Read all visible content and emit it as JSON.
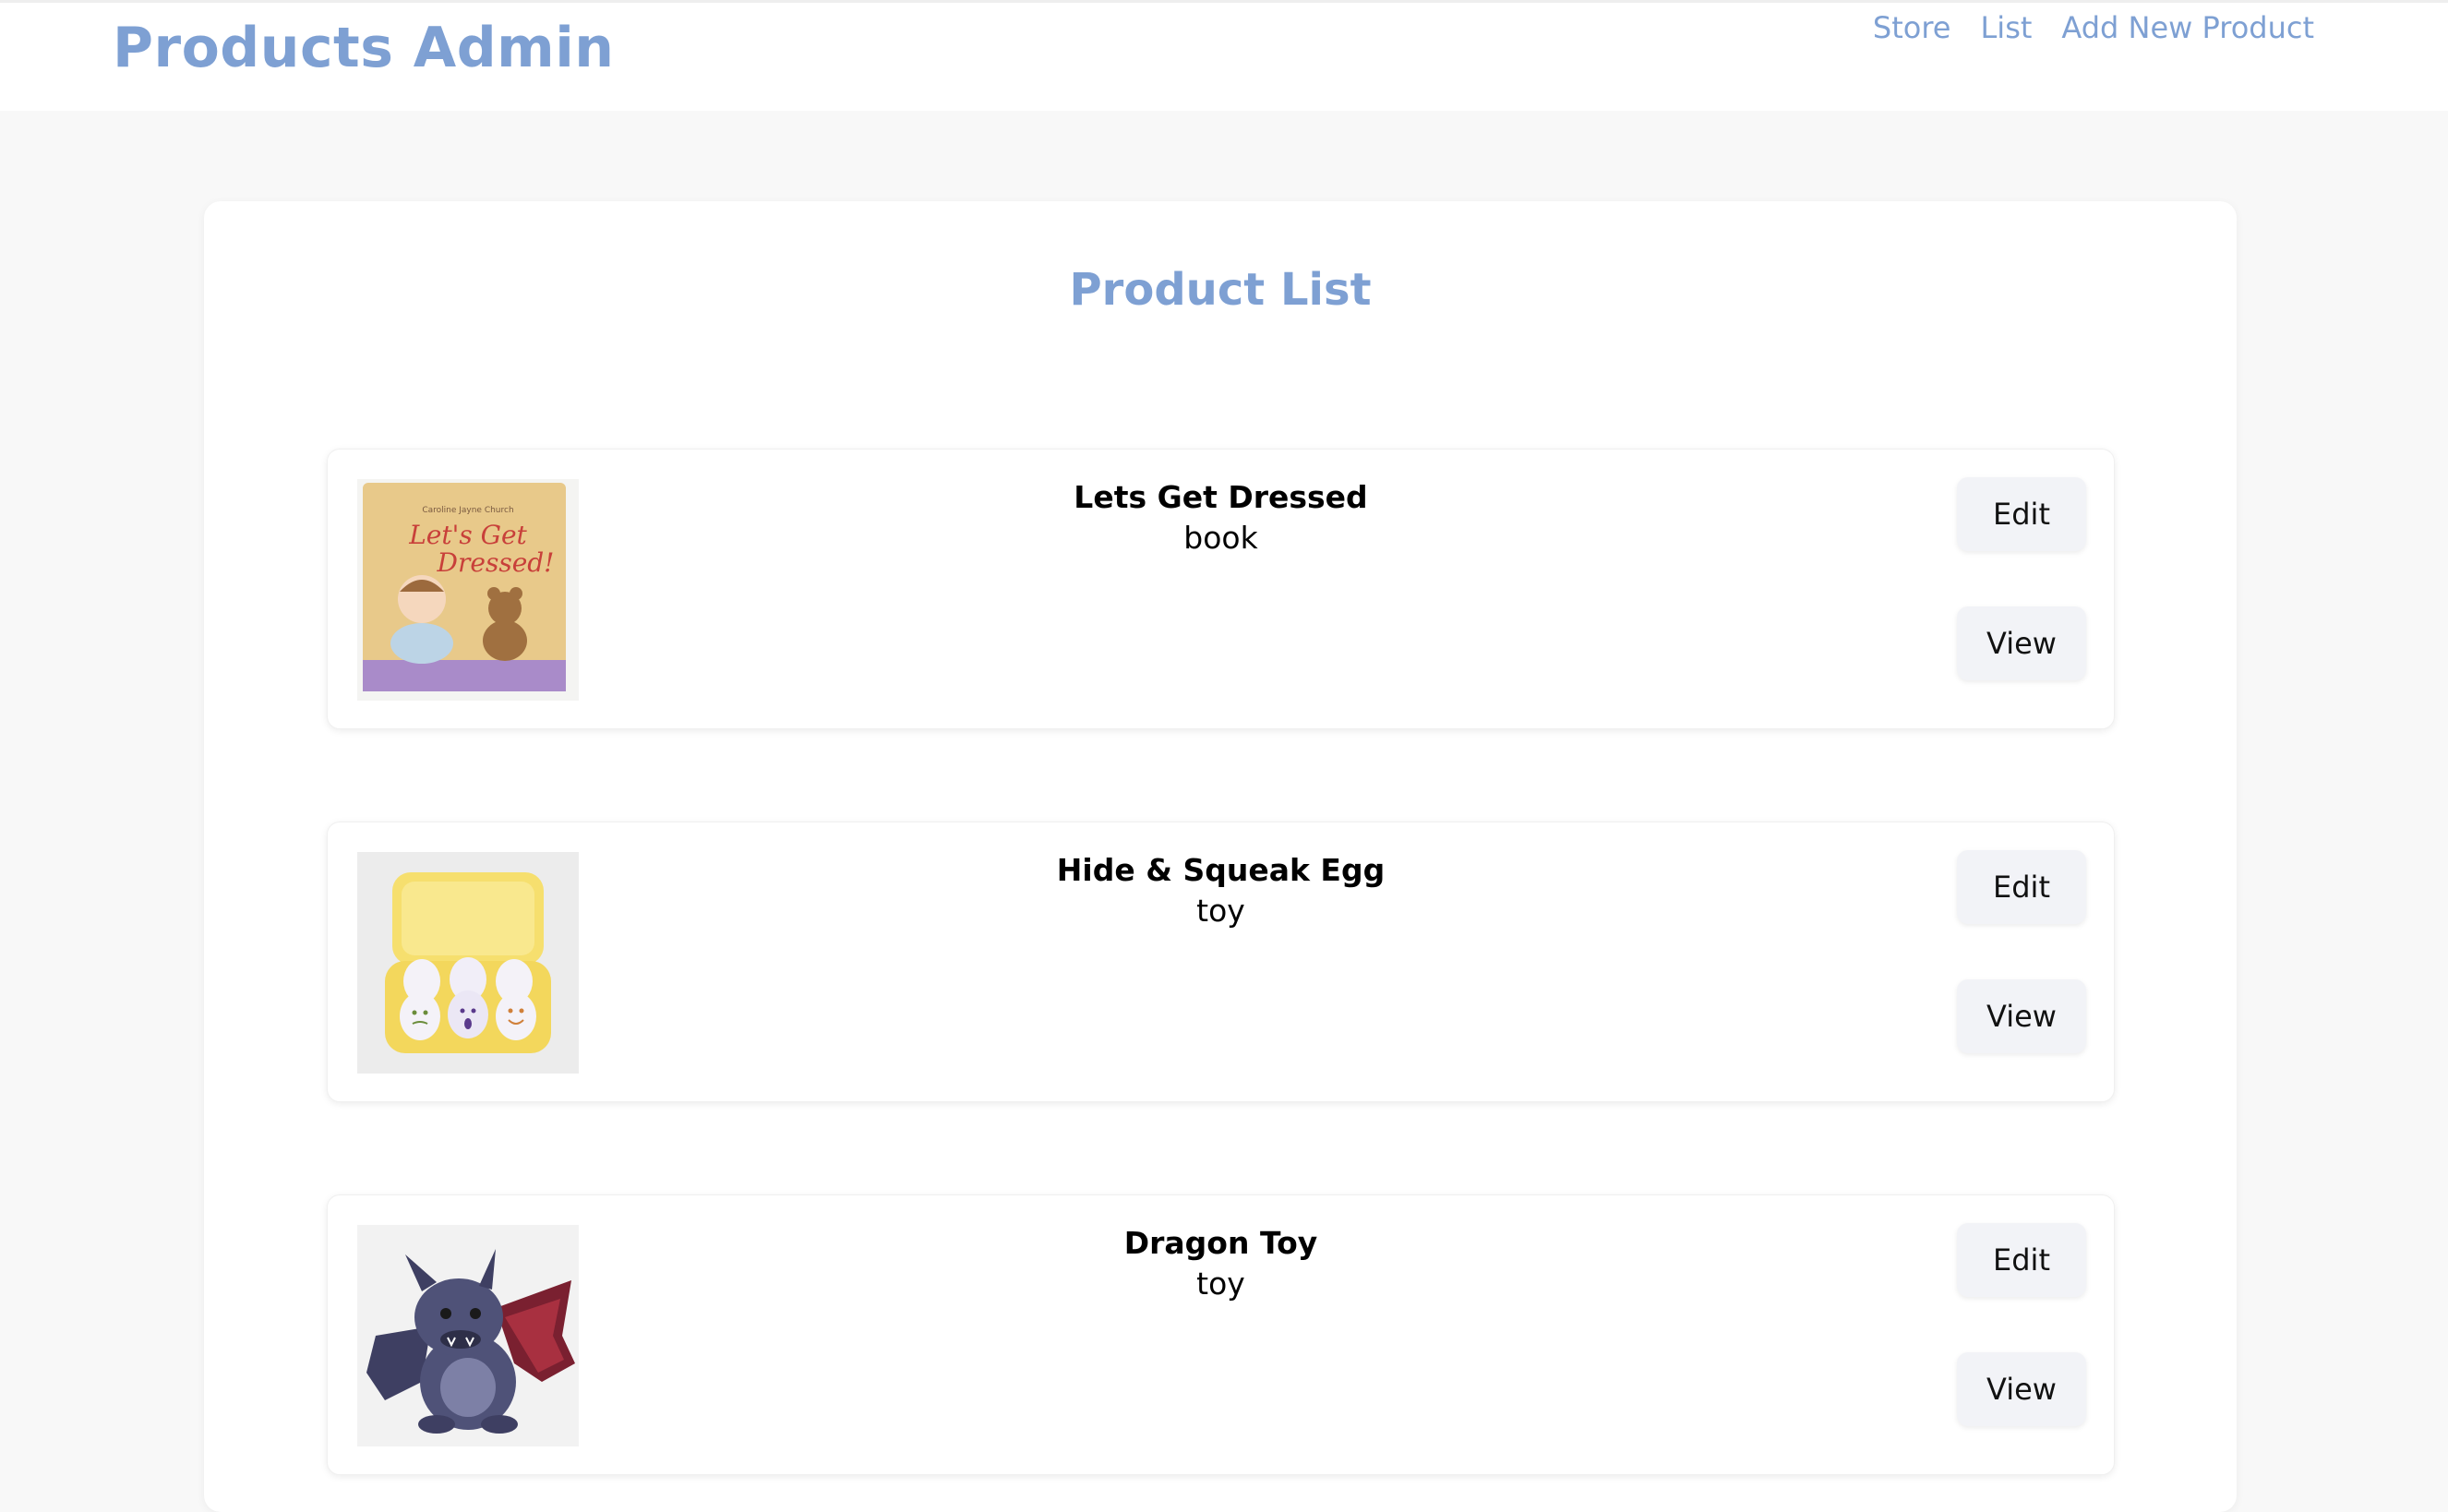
{
  "navbar": {
    "brand": "Products Admin",
    "links": [
      "Store",
      "List",
      "Add New Product"
    ]
  },
  "page": {
    "title": "Product List"
  },
  "products": [
    {
      "name": "Lets Get Dressed",
      "type": "book",
      "image": "book-cover-image",
      "image_text": {
        "author": "Caroline Jayne Church",
        "title_line1": "Let's Get",
        "title_line2": "Dressed!"
      },
      "edit_label": "Edit",
      "view_label": "View"
    },
    {
      "name": "Hide & Squeak Egg",
      "type": "toy",
      "image": "egg-carton-image",
      "edit_label": "Edit",
      "view_label": "View"
    },
    {
      "name": "Dragon Toy",
      "type": "toy",
      "image": "dragon-plush-image",
      "edit_label": "Edit",
      "view_label": "View"
    }
  ],
  "colors": {
    "accent": "#7ea0d3",
    "background": "#f8f8f8",
    "button_bg": "#f2f3f7"
  }
}
